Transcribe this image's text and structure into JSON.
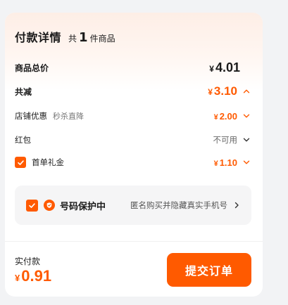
{
  "header": {
    "title": "付款详情",
    "count_prefix": "共",
    "count": "1",
    "count_suffix": "件商品"
  },
  "summary": {
    "goods_total_label": "商品总价",
    "goods_total_currency": "¥",
    "goods_total_amount": "4.01",
    "discount_label": "共减",
    "discount_currency": "¥",
    "discount_amount": "3.10"
  },
  "discounts": {
    "store_label": "店铺优惠",
    "store_sub": "秒杀直降",
    "store_currency": "¥",
    "store_amount": "2.00",
    "redpacket_label": "红包",
    "redpacket_value": "不可用",
    "firstorder_label": "首单礼金",
    "firstorder_currency": "¥",
    "firstorder_amount": "1.10",
    "firstorder_checked": true
  },
  "protection": {
    "title": "号码保护中",
    "description": "匿名购买并隐藏真实手机号",
    "checked": true
  },
  "footer": {
    "paid_label": "实付款",
    "paid_currency": "¥",
    "paid_amount": "0.91",
    "submit_label": "提交订单"
  },
  "colors": {
    "accent": "#ff5a00",
    "card_bg": "#ffffff",
    "page_bg": "#f2f3f5",
    "protect_bg": "#f5f5f6"
  },
  "icons": {
    "discount_toggle": "chevron-up-icon",
    "store_toggle": "chevron-down-icon",
    "redpacket_toggle": "chevron-down-icon",
    "firstorder_toggle": "chevron-down-icon",
    "protect_badge": "shield-icon",
    "protect_arrow": "chevron-right-icon",
    "checkbox": "checkmark-icon"
  }
}
